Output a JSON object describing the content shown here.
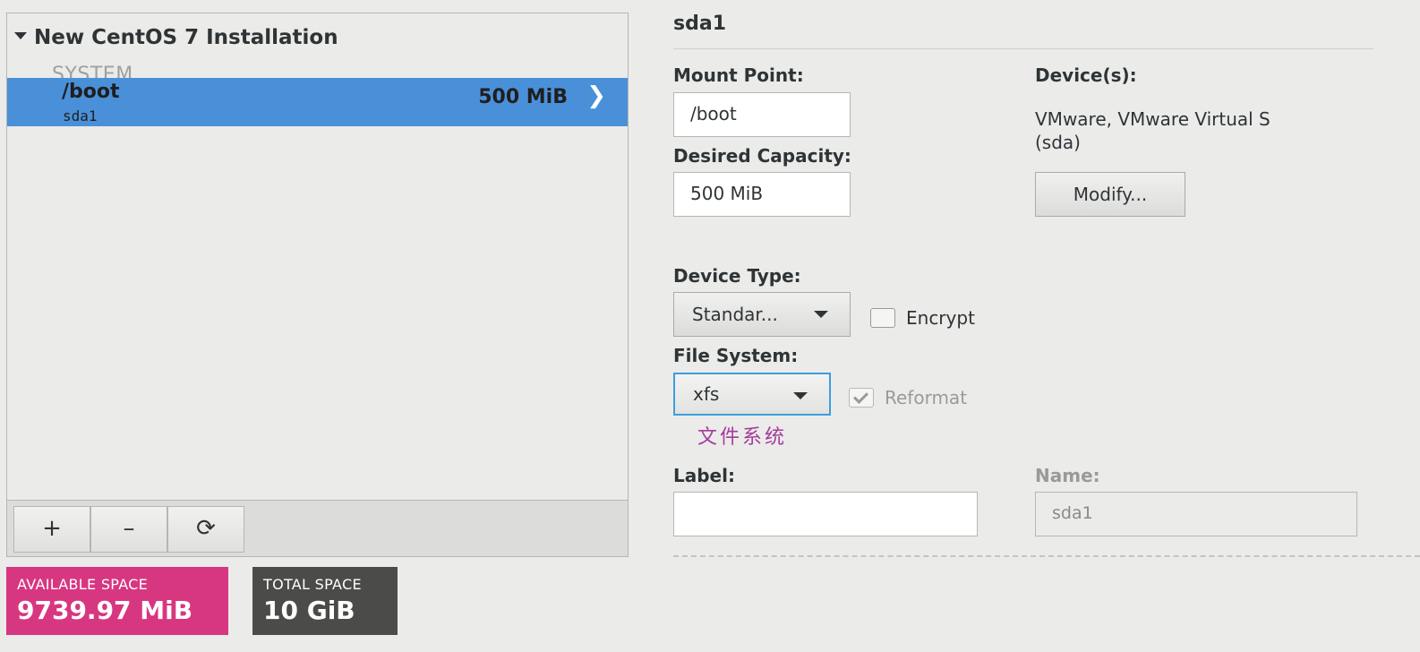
{
  "left": {
    "installation_title": "New CentOS 7 Installation",
    "section": "SYSTEM",
    "selected_mount": {
      "mount_point": "/boot",
      "device": "sda1",
      "size": "500 MiB"
    },
    "toolbar": {
      "add": "+",
      "remove": "–",
      "refresh": "⟳"
    },
    "available_space": {
      "caption": "AVAILABLE SPACE",
      "value": "9739.97 MiB"
    },
    "total_space": {
      "caption": "TOTAL SPACE",
      "value": "10 GiB"
    }
  },
  "detail": {
    "title": "sda1",
    "mount_point_label": "Mount Point:",
    "mount_point_value": "/boot",
    "desired_capacity_label": "Desired Capacity:",
    "desired_capacity_value": "500 MiB",
    "devices_label": "Device(s):",
    "devices_line1": "VMware, VMware Virtual S",
    "devices_line2": "(sda)",
    "modify_button": "Modify...",
    "device_type_label": "Device Type:",
    "device_type_value": "Standar...",
    "encrypt_label": "Encrypt",
    "encrypt_checked": false,
    "file_system_label": "File System:",
    "file_system_value": "xfs",
    "reformat_label": "Reformat",
    "reformat_checked": true,
    "annotation": "文件系统",
    "label_label": "Label:",
    "label_value": "",
    "name_label": "Name:",
    "name_value": "sda1"
  },
  "colors": {
    "selection": "#4a90d9",
    "available_space": "#d73780",
    "total_space": "#4b4b49",
    "focus_border": "#3c9ee0",
    "annotation": "#a43c9a"
  }
}
